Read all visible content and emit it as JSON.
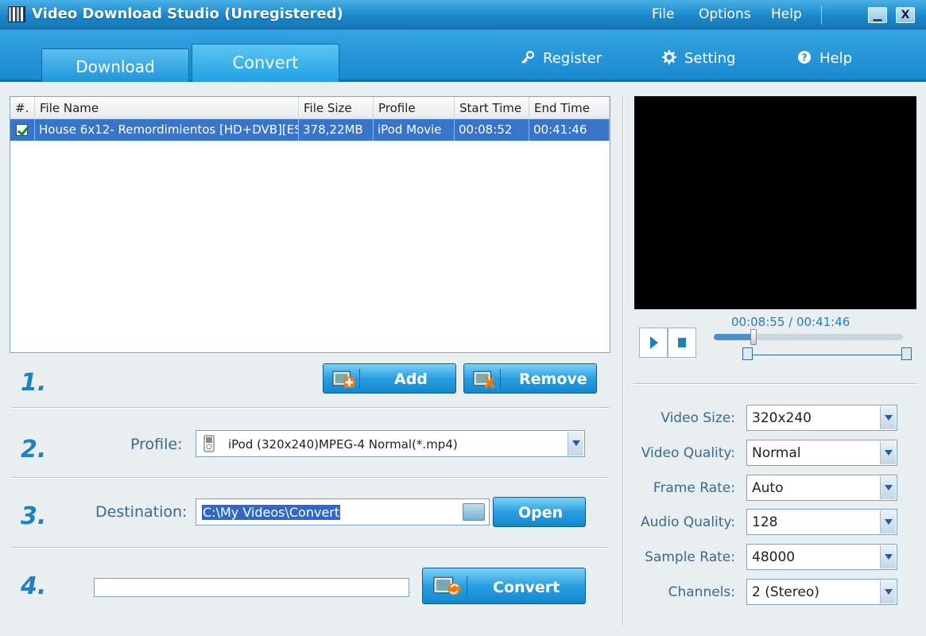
{
  "window": {
    "title": "Video Download Studio (Unregistered)",
    "menu": [
      "File",
      "Options",
      "Help"
    ],
    "minimize": "▁",
    "close": "X"
  },
  "tabs": {
    "download": "Download",
    "convert": "Convert"
  },
  "header_links": {
    "register": "Register",
    "setting": "Setting",
    "help": "Help"
  },
  "file_list": {
    "columns": [
      "#.",
      "File Name",
      "File Size",
      "Profile",
      "Start Time",
      "End Time"
    ],
    "rows": [
      {
        "checked": true,
        "file_name": "House 6x12- Remordimientos [HD+DVB][ES...",
        "file_size": "378,22MB",
        "profile": "iPod Movie",
        "start_time": "00:08:52",
        "end_time": "00:41:46"
      }
    ]
  },
  "steps": {
    "s1": "1.",
    "s2": "2.",
    "s3": "3.",
    "s4": "4."
  },
  "buttons": {
    "add": "Add",
    "remove": "Remove",
    "open": "Open",
    "convert": "Convert"
  },
  "profile": {
    "label": "Profile:",
    "value": "iPod (320x240)MPEG-4 Normal(*.mp4)"
  },
  "destination": {
    "label": "Destination:",
    "value": "C:\\My Videos\\Convert"
  },
  "player": {
    "timecode": "00:08:55 / 00:41:46",
    "progress_fraction": 0.21
  },
  "settings": [
    {
      "label": "Video Size:",
      "value": "320x240"
    },
    {
      "label": "Video Quality:",
      "value": "Normal"
    },
    {
      "label": "Frame Rate:",
      "value": "Auto"
    },
    {
      "label": "Audio Quality:",
      "value": "128"
    },
    {
      "label": "Sample Rate:",
      "value": "48000"
    },
    {
      "label": "Channels:",
      "value": "2 (Stereo)"
    }
  ],
  "colors": {
    "accent": "#1a8ad0",
    "selection": "#3874c8",
    "label": "#3a6b8c"
  }
}
